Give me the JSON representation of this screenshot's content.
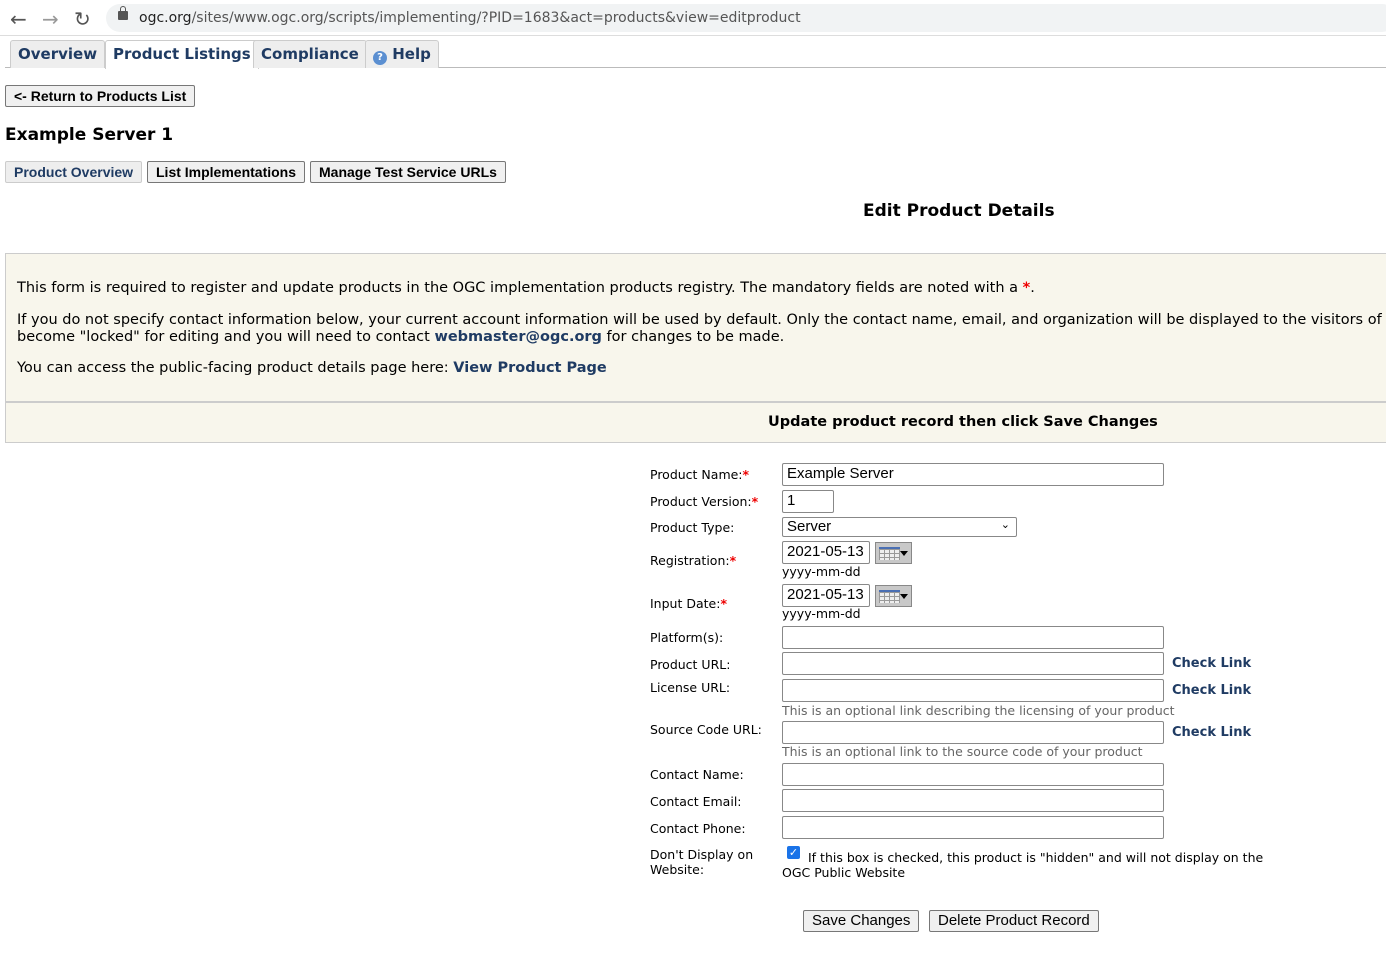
{
  "browser": {
    "url_host": "ogc.org",
    "url_rest": "/sites/www.ogc.org/scripts/implementing/?PID=1683&act=products&view=editproduct"
  },
  "tabs": [
    {
      "label": "Overview"
    },
    {
      "label": "Product Listings",
      "active": true
    },
    {
      "label": "Compliance"
    },
    {
      "label": "Help",
      "icon": "help-icon"
    }
  ],
  "return_label": "<- Return to Products List",
  "product_title": "Example Server 1",
  "subnav": [
    "Product Overview",
    "List Implementations",
    "Manage Test Service URLs"
  ],
  "section_title": "Edit Product Details",
  "info": {
    "p1": "This form is required to register and update products in the OGC implementation products registry. The mandatory fields are noted with a ",
    "p1_star": "*",
    "p1_end": ".",
    "p2a": "If you do not specify contact information below, your current account information will be used by default. Only the contact name, email, and organization will be displayed to the visitors of the r",
    "p2b": "become \"locked\" for editing and you will need to contact ",
    "p2_link": "webmaster@ogc.org",
    "p2c": " for changes to be made.",
    "p3": "You can access the public-facing product details page here: ",
    "p3_link": "View Product Page"
  },
  "save_bar": "Update product record then click Save Changes",
  "form": {
    "required_mark": "*",
    "product_name": {
      "label": "Product Name:",
      "value": "Example Server"
    },
    "product_version": {
      "label": "Product Version:",
      "value": "1"
    },
    "product_type": {
      "label": "Product Type:",
      "value": "Server"
    },
    "registration": {
      "label": "Registration:",
      "value": "2021-05-13",
      "format": "yyyy-mm-dd"
    },
    "input_date": {
      "label": "Input Date:",
      "value": "2021-05-13",
      "format": "yyyy-mm-dd"
    },
    "platforms": {
      "label": "Platform(s):",
      "value": ""
    },
    "product_url": {
      "label": "Product URL:",
      "value": ""
    },
    "license_url": {
      "label": "License URL:",
      "value": "",
      "hint": "This is an optional link describing the licensing of your product"
    },
    "source_url": {
      "label": "Source Code URL:",
      "value": "",
      "hint": "This is an optional link to the source code of your product"
    },
    "check_link": "Check Link",
    "contact_name": {
      "label": "Contact Name:",
      "value": ""
    },
    "contact_email": {
      "label": "Contact Email:",
      "value": ""
    },
    "contact_phone": {
      "label": "Contact Phone:",
      "value": ""
    },
    "dont_display": {
      "label1": "Don't Display on",
      "label2": "Website:",
      "checked": true,
      "text1": "If this box is checked, this product is \"hidden\" and will not display on the",
      "text2": "OGC Public Website"
    },
    "save": "Save Changes",
    "delete": "Delete Product Record"
  }
}
